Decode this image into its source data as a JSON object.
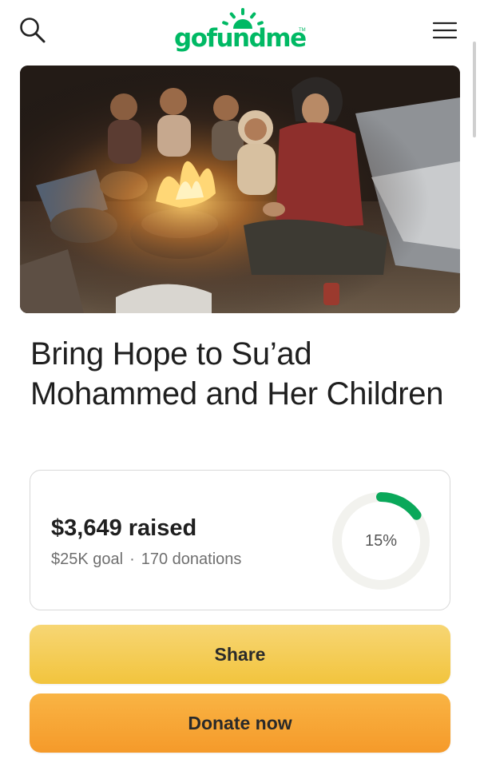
{
  "header": {
    "logo_text": "gofundme",
    "logo_tm": "TM",
    "brand_color": "#00b964",
    "icons": {
      "search": "search-icon",
      "menu": "hamburger-menu-icon"
    }
  },
  "campaign": {
    "image": "photo of a mother and children sitting around a cooking fire",
    "title": "Bring Hope to Su’ad Mohammed and Her Children"
  },
  "stats": {
    "raised_amount": "$3,649",
    "raised_suffix": " raised",
    "goal": "$25K goal",
    "separator": "·",
    "donations": "170 donations",
    "percent_label": "15%",
    "progress_fraction": 0.15,
    "progress_color": "#0aa85a",
    "track_color": "#f2f2ee"
  },
  "actions": {
    "share_label": "Share",
    "donate_label": "Donate now",
    "share_color": "#f4cb52",
    "donate_color": "#f7a535"
  }
}
